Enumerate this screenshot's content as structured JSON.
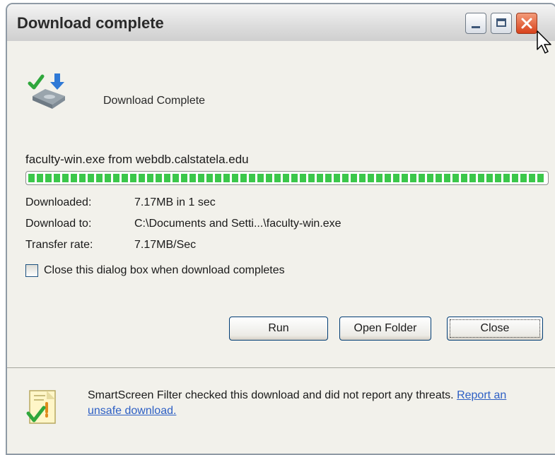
{
  "window": {
    "title": "Download complete"
  },
  "header": {
    "text": "Download Complete"
  },
  "download": {
    "file_line": "faculty-win.exe from webdb.calstatela.edu",
    "progress": 1.0,
    "rows": [
      {
        "label": "Downloaded:",
        "value": "7.17MB in 1 sec"
      },
      {
        "label": "Download to:",
        "value": "C:\\Documents and Setti...\\faculty-win.exe"
      },
      {
        "label": "Transfer rate:",
        "value": "7.17MB/Sec"
      }
    ]
  },
  "options": {
    "close_when_done_label": "Close this dialog box when download completes",
    "close_when_done_checked": false
  },
  "buttons": {
    "run": "Run",
    "open_folder": "Open Folder",
    "close": "Close"
  },
  "footer": {
    "message": "SmartScreen Filter checked this download and did not report any threats.",
    "link": "Report an unsafe download."
  },
  "colors": {
    "progress": "#3bc74a",
    "link": "#2d5fc4",
    "close_button": "#d8411b"
  },
  "icons": {
    "header": "download-complete-icon",
    "footer": "smartscreen-check-icon",
    "min": "minimize-icon",
    "max": "maximize-icon",
    "close": "close-icon"
  }
}
